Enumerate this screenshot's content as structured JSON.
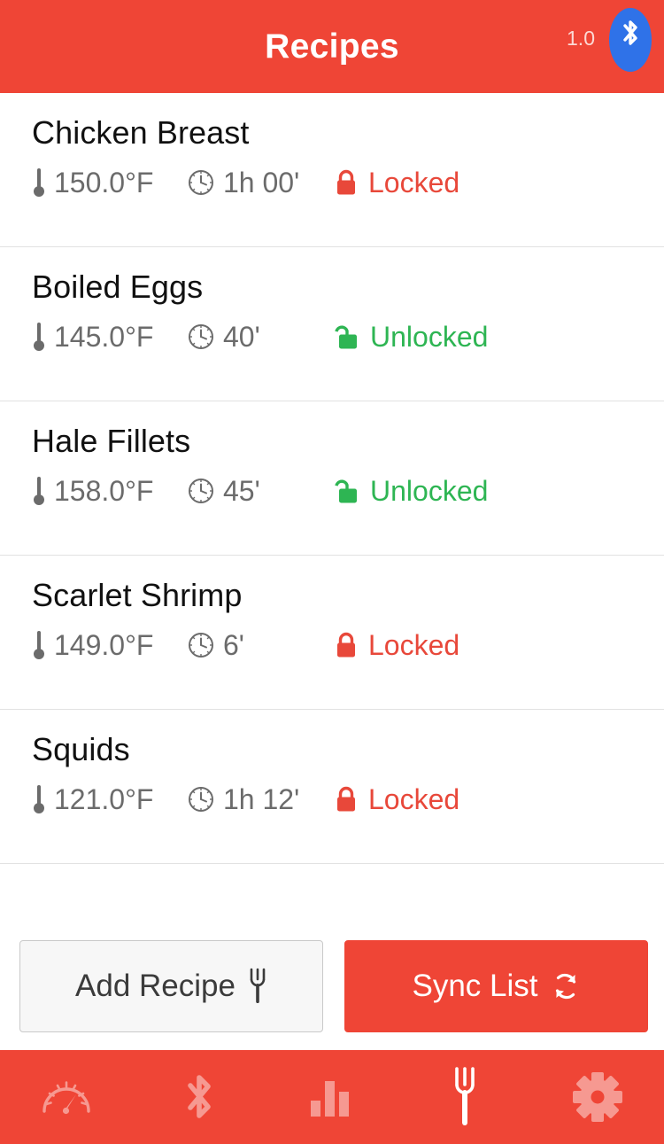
{
  "header": {
    "title": "Recipes",
    "version": "1.0",
    "bluetooth_icon": "bluetooth-icon",
    "bg_color": "#ef4536",
    "badge_color": "#2f72e8"
  },
  "colors": {
    "accent": "#ef4536",
    "locked": "#e8483a",
    "unlocked": "#2eb553",
    "meta_text": "#6b6b6b",
    "title_text": "#111111"
  },
  "list": {
    "temp_icon": "thermometer-icon",
    "time_icon": "clock-icon",
    "locked_icon": "lock-closed-icon",
    "unlocked_icon": "lock-open-icon",
    "recipes": [
      {
        "name": "Chicken Breast",
        "temperature": "150.0°F",
        "duration": "1h 00'",
        "status": "Locked",
        "locked": true
      },
      {
        "name": "Boiled Eggs",
        "temperature": "145.0°F",
        "duration": "40'",
        "status": "Unlocked",
        "locked": false
      },
      {
        "name": "Hale Fillets",
        "temperature": "158.0°F",
        "duration": "45'",
        "status": "Unlocked",
        "locked": false
      },
      {
        "name": "Scarlet Shrimp",
        "temperature": "149.0°F",
        "duration": "6'",
        "status": "Locked",
        "locked": true
      },
      {
        "name": "Squids",
        "temperature": "121.0°F",
        "duration": "1h 12'",
        "status": "Locked",
        "locked": true
      }
    ]
  },
  "actions": {
    "add_recipe_label": "Add Recipe",
    "add_recipe_icon": "fork-icon",
    "sync_list_label": "Sync List",
    "sync_list_icon": "sync-icon"
  },
  "tabbar": {
    "items": [
      {
        "name": "gauge",
        "icon": "gauge-icon",
        "active": false
      },
      {
        "name": "bluetooth",
        "icon": "bluetooth-icon",
        "active": false
      },
      {
        "name": "stats",
        "icon": "bar-chart-icon",
        "active": false
      },
      {
        "name": "recipes",
        "icon": "fork-icon",
        "active": true
      },
      {
        "name": "settings",
        "icon": "gear-icon",
        "active": false
      }
    ]
  }
}
